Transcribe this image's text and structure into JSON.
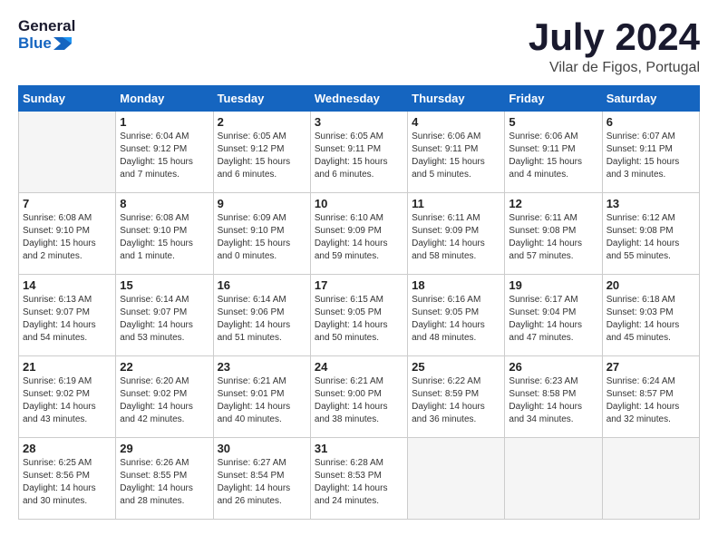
{
  "header": {
    "logo_general": "General",
    "logo_blue": "Blue",
    "month_title": "July 2024",
    "location": "Vilar de Figos, Portugal"
  },
  "days_of_week": [
    "Sunday",
    "Monday",
    "Tuesday",
    "Wednesday",
    "Thursday",
    "Friday",
    "Saturday"
  ],
  "weeks": [
    [
      {
        "day": "",
        "empty": true
      },
      {
        "day": "1",
        "sunrise": "Sunrise: 6:04 AM",
        "sunset": "Sunset: 9:12 PM",
        "daylight": "Daylight: 15 hours and 7 minutes."
      },
      {
        "day": "2",
        "sunrise": "Sunrise: 6:05 AM",
        "sunset": "Sunset: 9:12 PM",
        "daylight": "Daylight: 15 hours and 6 minutes."
      },
      {
        "day": "3",
        "sunrise": "Sunrise: 6:05 AM",
        "sunset": "Sunset: 9:11 PM",
        "daylight": "Daylight: 15 hours and 6 minutes."
      },
      {
        "day": "4",
        "sunrise": "Sunrise: 6:06 AM",
        "sunset": "Sunset: 9:11 PM",
        "daylight": "Daylight: 15 hours and 5 minutes."
      },
      {
        "day": "5",
        "sunrise": "Sunrise: 6:06 AM",
        "sunset": "Sunset: 9:11 PM",
        "daylight": "Daylight: 15 hours and 4 minutes."
      },
      {
        "day": "6",
        "sunrise": "Sunrise: 6:07 AM",
        "sunset": "Sunset: 9:11 PM",
        "daylight": "Daylight: 15 hours and 3 minutes."
      }
    ],
    [
      {
        "day": "7",
        "sunrise": "Sunrise: 6:08 AM",
        "sunset": "Sunset: 9:10 PM",
        "daylight": "Daylight: 15 hours and 2 minutes."
      },
      {
        "day": "8",
        "sunrise": "Sunrise: 6:08 AM",
        "sunset": "Sunset: 9:10 PM",
        "daylight": "Daylight: 15 hours and 1 minute."
      },
      {
        "day": "9",
        "sunrise": "Sunrise: 6:09 AM",
        "sunset": "Sunset: 9:10 PM",
        "daylight": "Daylight: 15 hours and 0 minutes."
      },
      {
        "day": "10",
        "sunrise": "Sunrise: 6:10 AM",
        "sunset": "Sunset: 9:09 PM",
        "daylight": "Daylight: 14 hours and 59 minutes."
      },
      {
        "day": "11",
        "sunrise": "Sunrise: 6:11 AM",
        "sunset": "Sunset: 9:09 PM",
        "daylight": "Daylight: 14 hours and 58 minutes."
      },
      {
        "day": "12",
        "sunrise": "Sunrise: 6:11 AM",
        "sunset": "Sunset: 9:08 PM",
        "daylight": "Daylight: 14 hours and 57 minutes."
      },
      {
        "day": "13",
        "sunrise": "Sunrise: 6:12 AM",
        "sunset": "Sunset: 9:08 PM",
        "daylight": "Daylight: 14 hours and 55 minutes."
      }
    ],
    [
      {
        "day": "14",
        "sunrise": "Sunrise: 6:13 AM",
        "sunset": "Sunset: 9:07 PM",
        "daylight": "Daylight: 14 hours and 54 minutes."
      },
      {
        "day": "15",
        "sunrise": "Sunrise: 6:14 AM",
        "sunset": "Sunset: 9:07 PM",
        "daylight": "Daylight: 14 hours and 53 minutes."
      },
      {
        "day": "16",
        "sunrise": "Sunrise: 6:14 AM",
        "sunset": "Sunset: 9:06 PM",
        "daylight": "Daylight: 14 hours and 51 minutes."
      },
      {
        "day": "17",
        "sunrise": "Sunrise: 6:15 AM",
        "sunset": "Sunset: 9:05 PM",
        "daylight": "Daylight: 14 hours and 50 minutes."
      },
      {
        "day": "18",
        "sunrise": "Sunrise: 6:16 AM",
        "sunset": "Sunset: 9:05 PM",
        "daylight": "Daylight: 14 hours and 48 minutes."
      },
      {
        "day": "19",
        "sunrise": "Sunrise: 6:17 AM",
        "sunset": "Sunset: 9:04 PM",
        "daylight": "Daylight: 14 hours and 47 minutes."
      },
      {
        "day": "20",
        "sunrise": "Sunrise: 6:18 AM",
        "sunset": "Sunset: 9:03 PM",
        "daylight": "Daylight: 14 hours and 45 minutes."
      }
    ],
    [
      {
        "day": "21",
        "sunrise": "Sunrise: 6:19 AM",
        "sunset": "Sunset: 9:02 PM",
        "daylight": "Daylight: 14 hours and 43 minutes."
      },
      {
        "day": "22",
        "sunrise": "Sunrise: 6:20 AM",
        "sunset": "Sunset: 9:02 PM",
        "daylight": "Daylight: 14 hours and 42 minutes."
      },
      {
        "day": "23",
        "sunrise": "Sunrise: 6:21 AM",
        "sunset": "Sunset: 9:01 PM",
        "daylight": "Daylight: 14 hours and 40 minutes."
      },
      {
        "day": "24",
        "sunrise": "Sunrise: 6:21 AM",
        "sunset": "Sunset: 9:00 PM",
        "daylight": "Daylight: 14 hours and 38 minutes."
      },
      {
        "day": "25",
        "sunrise": "Sunrise: 6:22 AM",
        "sunset": "Sunset: 8:59 PM",
        "daylight": "Daylight: 14 hours and 36 minutes."
      },
      {
        "day": "26",
        "sunrise": "Sunrise: 6:23 AM",
        "sunset": "Sunset: 8:58 PM",
        "daylight": "Daylight: 14 hours and 34 minutes."
      },
      {
        "day": "27",
        "sunrise": "Sunrise: 6:24 AM",
        "sunset": "Sunset: 8:57 PM",
        "daylight": "Daylight: 14 hours and 32 minutes."
      }
    ],
    [
      {
        "day": "28",
        "sunrise": "Sunrise: 6:25 AM",
        "sunset": "Sunset: 8:56 PM",
        "daylight": "Daylight: 14 hours and 30 minutes."
      },
      {
        "day": "29",
        "sunrise": "Sunrise: 6:26 AM",
        "sunset": "Sunset: 8:55 PM",
        "daylight": "Daylight: 14 hours and 28 minutes."
      },
      {
        "day": "30",
        "sunrise": "Sunrise: 6:27 AM",
        "sunset": "Sunset: 8:54 PM",
        "daylight": "Daylight: 14 hours and 26 minutes."
      },
      {
        "day": "31",
        "sunrise": "Sunrise: 6:28 AM",
        "sunset": "Sunset: 8:53 PM",
        "daylight": "Daylight: 14 hours and 24 minutes."
      },
      {
        "day": "",
        "empty": true
      },
      {
        "day": "",
        "empty": true
      },
      {
        "day": "",
        "empty": true
      }
    ]
  ]
}
